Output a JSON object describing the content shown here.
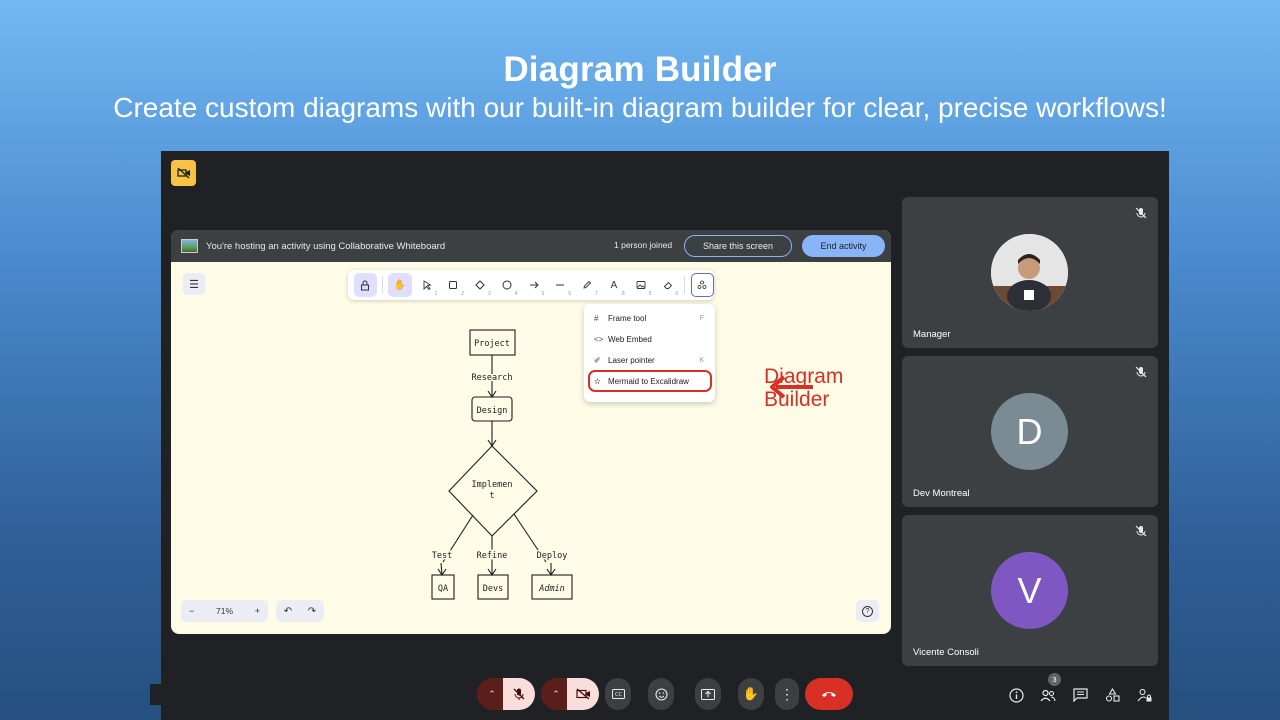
{
  "hero": {
    "title": "Diagram Builder",
    "subtitle": "Create custom diagrams with our built-in diagram builder for clear, precise workflows!"
  },
  "activity_banner": {
    "text": "You're hosting an activity using Collaborative Whiteboard",
    "people": "1 person joined",
    "share_label": "Share this screen",
    "end_label": "End activity"
  },
  "toolbar": {
    "tools": [
      {
        "icon": "lock-icon",
        "num": ""
      },
      {
        "icon": "hand-icon",
        "num": ""
      },
      {
        "icon": "selection-icon",
        "num": "1"
      },
      {
        "icon": "rectangle-icon",
        "num": "2"
      },
      {
        "icon": "diamond-icon",
        "num": "3"
      },
      {
        "icon": "ellipse-icon",
        "num": "4"
      },
      {
        "icon": "arrow-icon",
        "num": "5"
      },
      {
        "icon": "line-icon",
        "num": "6"
      },
      {
        "icon": "pencil-icon",
        "num": "7"
      },
      {
        "icon": "text-icon",
        "num": "8"
      },
      {
        "icon": "image-icon",
        "num": "9"
      },
      {
        "icon": "eraser-icon",
        "num": "0"
      },
      {
        "icon": "extra-tools-icon",
        "num": ""
      }
    ]
  },
  "dropdown": {
    "items": [
      {
        "icon": "frame-icon",
        "label": "Frame tool",
        "key": "F"
      },
      {
        "icon": "embed-icon",
        "label": "Web Embed",
        "key": ""
      },
      {
        "icon": "laser-icon",
        "label": "Laser pointer",
        "key": "K"
      },
      {
        "icon": "mermaid-icon",
        "label": "Mermaid to Excalidraw",
        "key": ""
      }
    ]
  },
  "diagram": {
    "nodes": {
      "project": "Project",
      "design": "Design",
      "implement_1": "Implemen",
      "implement_2": "t",
      "qa": "QA",
      "devs": "Devs",
      "admin": "Admin"
    },
    "edges": {
      "research": "Research",
      "test": "Test",
      "refine": "Refine",
      "deploy": "Deploy"
    }
  },
  "annotation": {
    "line1": "Diagram",
    "line2": "Builder",
    "color": "#d93025"
  },
  "zoom": {
    "minus": "−",
    "value": "71%",
    "plus": "+"
  },
  "help": "?",
  "participants": [
    {
      "name": "Manager",
      "initial": "",
      "color": "#c9c9c9"
    },
    {
      "name": "Dev Montreal",
      "initial": "D",
      "color": "#7b8b93"
    },
    {
      "name": "Vicente Consoli",
      "initial": "V",
      "color": "#7e57c2"
    }
  ],
  "bottom_bar": {
    "people_count": "3"
  },
  "colors": {
    "meet_bg": "#202124",
    "tile_bg": "#3c4043",
    "accent_blue": "#8ab4f8",
    "end_call_red": "#d93025",
    "whiteboard_bg": "#fefbe6"
  }
}
